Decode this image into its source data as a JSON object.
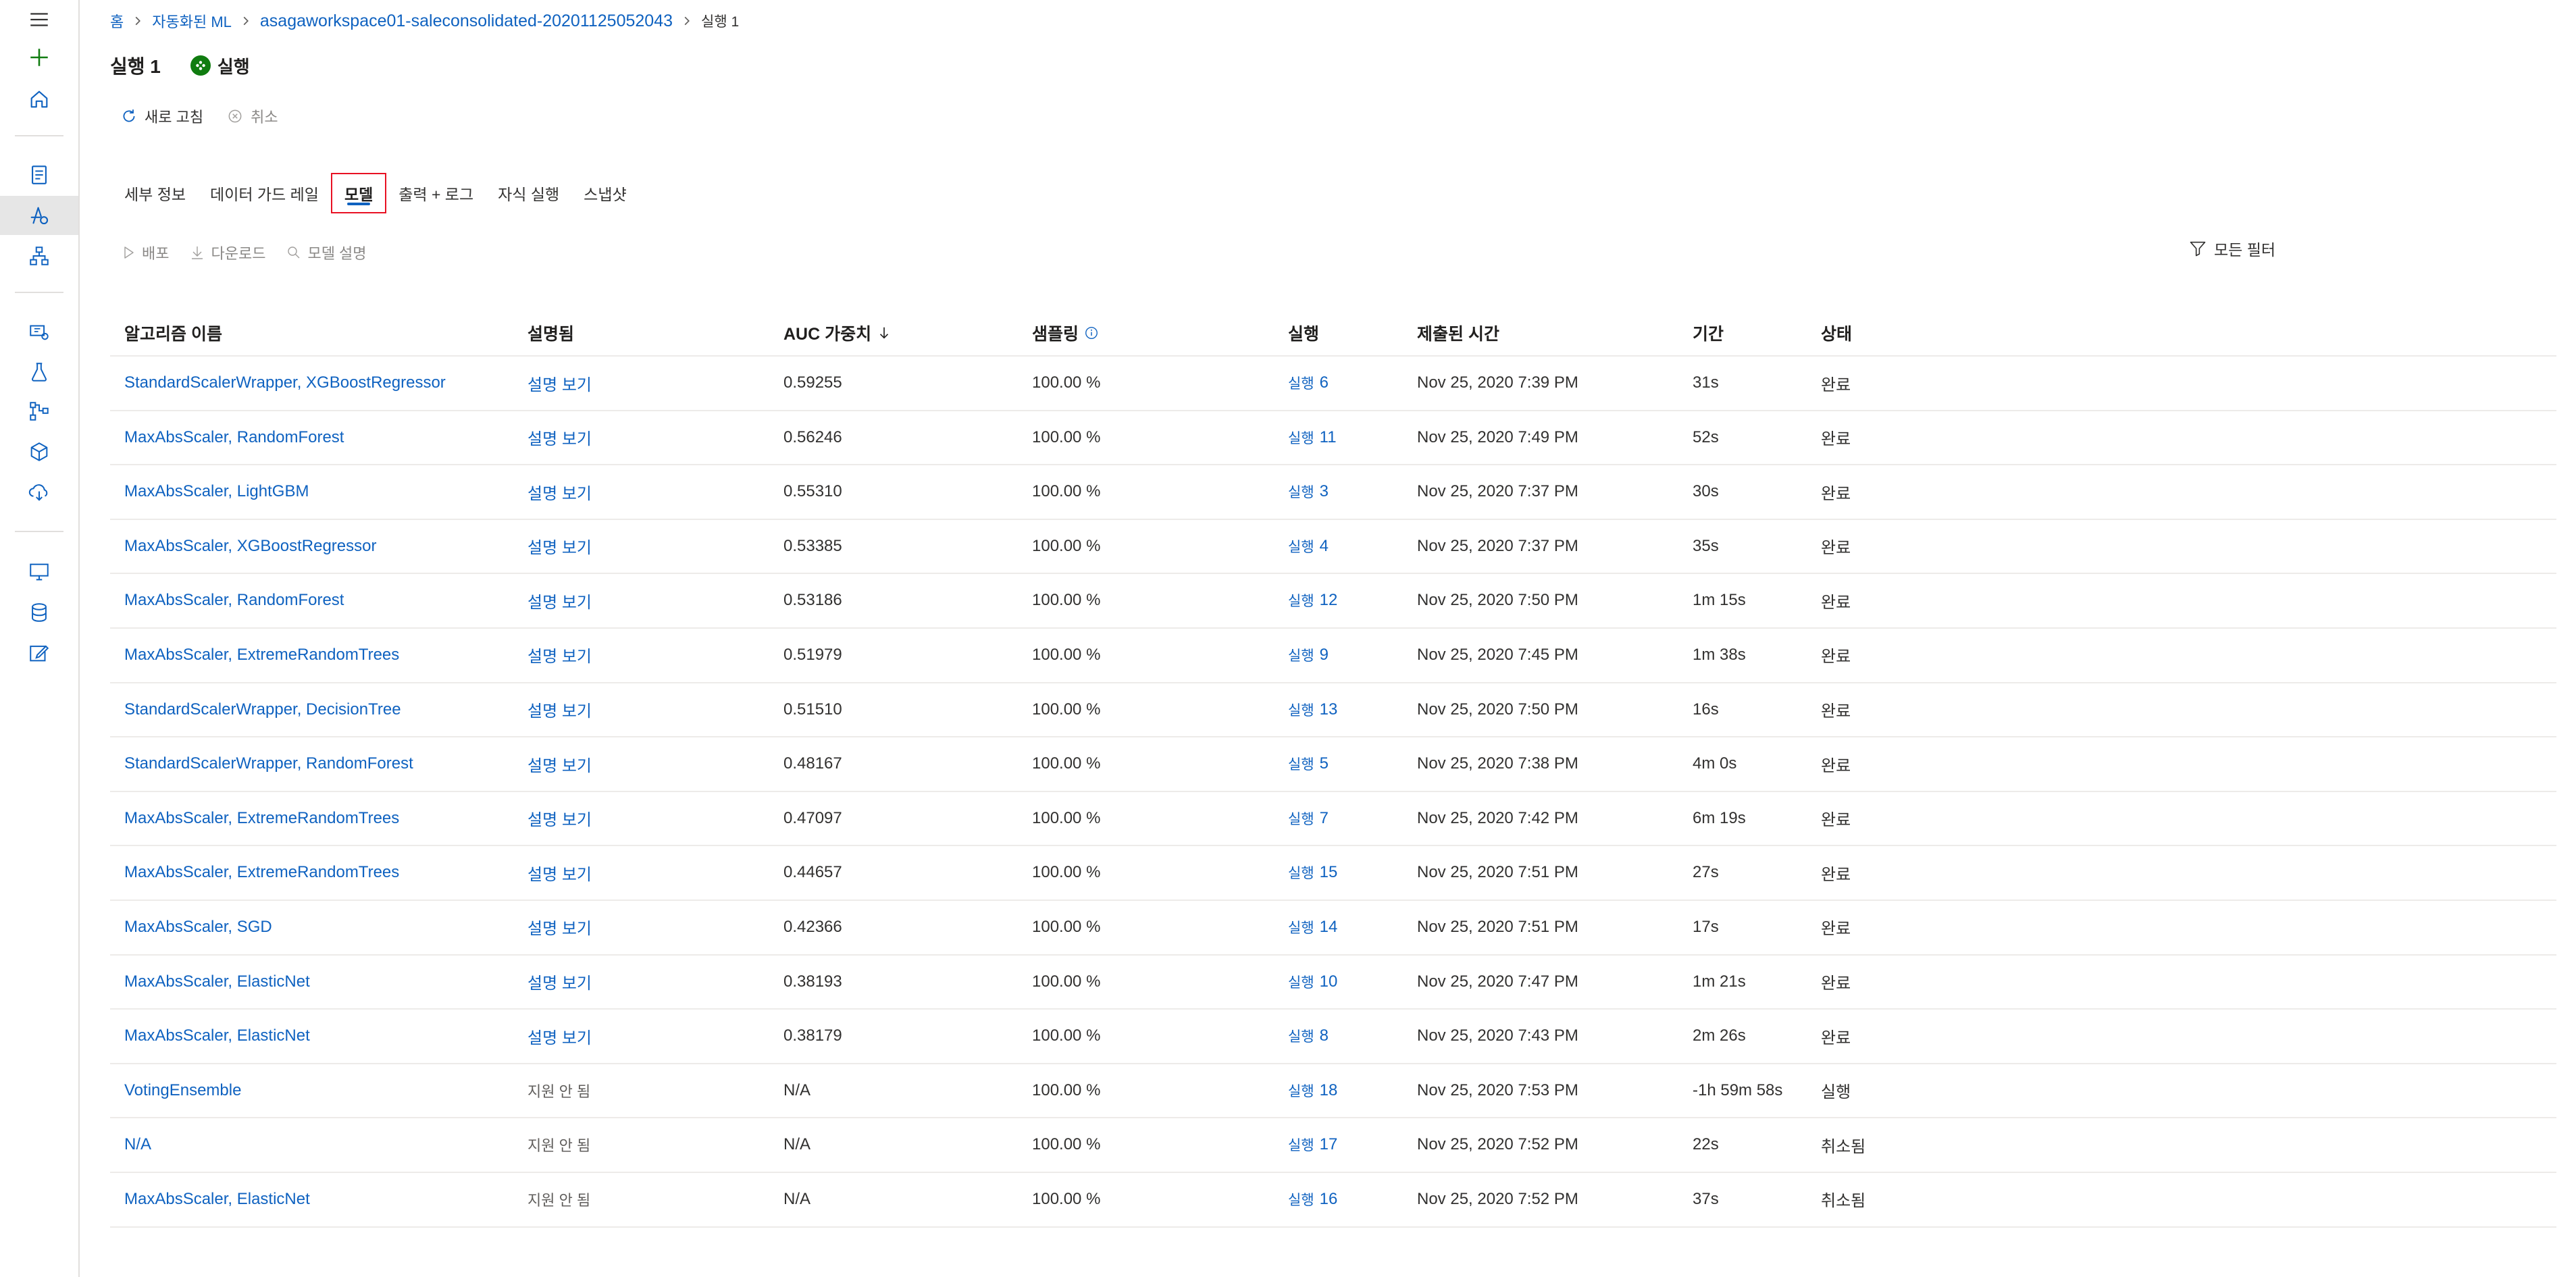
{
  "breadcrumb": {
    "home": "홈",
    "automl": "자동화된 ML",
    "experiment": "asagaworkspace01-saleconsolidated-20201125052043",
    "current": "실행 1"
  },
  "header": {
    "title": "실행 1",
    "status_label": "실행",
    "status_color": "#107c10"
  },
  "toolbar": {
    "refresh_label": "새로 고침",
    "cancel_label": "취소"
  },
  "tabs": [
    {
      "label": "세부 정보"
    },
    {
      "label": "데이터 가드 레일"
    },
    {
      "label": "모델",
      "selected": true
    },
    {
      "label": "출력 + 로그"
    },
    {
      "label": "자식 실행"
    },
    {
      "label": "스냅샷"
    }
  ],
  "model_actions": {
    "deploy_label": "배포",
    "download_label": "다운로드",
    "explain_label": "모델 설명",
    "filter_label": "모든 필터"
  },
  "table": {
    "columns": {
      "algorithm": "알고리즘 이름",
      "explained": "설명됨",
      "auc": "AUC 가중치",
      "sampling": "샘플링",
      "run": "실행",
      "submitted": "제출된 시간",
      "duration": "기간",
      "status": "상태"
    },
    "rows": [
      {
        "algorithm": "StandardScalerWrapper, XGBoostRegressor",
        "explained": "설명 보기",
        "explained_link": true,
        "auc": "0.59255",
        "sampling": "100.00 %",
        "run_prefix": "실행",
        "run_num": "6",
        "submitted": "Nov 25, 2020 7:39 PM",
        "duration": "31s",
        "status": "완료"
      },
      {
        "algorithm": "MaxAbsScaler, RandomForest",
        "explained": "설명 보기",
        "explained_link": true,
        "auc": "0.56246",
        "sampling": "100.00 %",
        "run_prefix": "실행",
        "run_num": "11",
        "submitted": "Nov 25, 2020 7:49 PM",
        "duration": "52s",
        "status": "완료"
      },
      {
        "algorithm": "MaxAbsScaler, LightGBM",
        "explained": "설명 보기",
        "explained_link": true,
        "auc": "0.55310",
        "sampling": "100.00 %",
        "run_prefix": "실행",
        "run_num": "3",
        "submitted": "Nov 25, 2020 7:37 PM",
        "duration": "30s",
        "status": "완료"
      },
      {
        "algorithm": "MaxAbsScaler, XGBoostRegressor",
        "explained": "설명 보기",
        "explained_link": true,
        "auc": "0.53385",
        "sampling": "100.00 %",
        "run_prefix": "실행",
        "run_num": "4",
        "submitted": "Nov 25, 2020 7:37 PM",
        "duration": "35s",
        "status": "완료"
      },
      {
        "algorithm": "MaxAbsScaler, RandomForest",
        "explained": "설명 보기",
        "explained_link": true,
        "auc": "0.53186",
        "sampling": "100.00 %",
        "run_prefix": "실행",
        "run_num": "12",
        "submitted": "Nov 25, 2020 7:50 PM",
        "duration": "1m 15s",
        "status": "완료"
      },
      {
        "algorithm": "MaxAbsScaler, ExtremeRandomTrees",
        "explained": "설명 보기",
        "explained_link": true,
        "auc": "0.51979",
        "sampling": "100.00 %",
        "run_prefix": "실행",
        "run_num": "9",
        "submitted": "Nov 25, 2020 7:45 PM",
        "duration": "1m 38s",
        "status": "완료"
      },
      {
        "algorithm": "StandardScalerWrapper, DecisionTree",
        "explained": "설명 보기",
        "explained_link": true,
        "auc": "0.51510",
        "sampling": "100.00 %",
        "run_prefix": "실행",
        "run_num": "13",
        "submitted": "Nov 25, 2020 7:50 PM",
        "duration": "16s",
        "status": "완료"
      },
      {
        "algorithm": "StandardScalerWrapper, RandomForest",
        "explained": "설명 보기",
        "explained_link": true,
        "auc": "0.48167",
        "sampling": "100.00 %",
        "run_prefix": "실행",
        "run_num": "5",
        "submitted": "Nov 25, 2020 7:38 PM",
        "duration": "4m 0s",
        "status": "완료"
      },
      {
        "algorithm": "MaxAbsScaler, ExtremeRandomTrees",
        "explained": "설명 보기",
        "explained_link": true,
        "auc": "0.47097",
        "sampling": "100.00 %",
        "run_prefix": "실행",
        "run_num": "7",
        "submitted": "Nov 25, 2020 7:42 PM",
        "duration": "6m 19s",
        "status": "완료"
      },
      {
        "algorithm": "MaxAbsScaler, ExtremeRandomTrees",
        "explained": "설명 보기",
        "explained_link": true,
        "auc": "0.44657",
        "sampling": "100.00 %",
        "run_prefix": "실행",
        "run_num": "15",
        "submitted": "Nov 25, 2020 7:51 PM",
        "duration": "27s",
        "status": "완료"
      },
      {
        "algorithm": "MaxAbsScaler, SGD",
        "explained": "설명 보기",
        "explained_link": true,
        "auc": "0.42366",
        "sampling": "100.00 %",
        "run_prefix": "실행",
        "run_num": "14",
        "submitted": "Nov 25, 2020 7:51 PM",
        "duration": "17s",
        "status": "완료"
      },
      {
        "algorithm": "MaxAbsScaler, ElasticNet",
        "explained": "설명 보기",
        "explained_link": true,
        "auc": "0.38193",
        "sampling": "100.00 %",
        "run_prefix": "실행",
        "run_num": "10",
        "submitted": "Nov 25, 2020 7:47 PM",
        "duration": "1m 21s",
        "status": "완료"
      },
      {
        "algorithm": "MaxAbsScaler, ElasticNet",
        "explained": "설명 보기",
        "explained_link": true,
        "auc": "0.38179",
        "sampling": "100.00 %",
        "run_prefix": "실행",
        "run_num": "8",
        "submitted": "Nov 25, 2020 7:43 PM",
        "duration": "2m 26s",
        "status": "완료"
      },
      {
        "algorithm": "VotingEnsemble",
        "explained": "지원 안 됨",
        "explained_link": false,
        "auc": "N/A",
        "sampling": "100.00 %",
        "run_prefix": "실행",
        "run_num": "18",
        "submitted": "Nov 25, 2020 7:53 PM",
        "duration": "-1h 59m 58s",
        "status": "실행"
      },
      {
        "algorithm": "N/A",
        "explained": "지원 안 됨",
        "explained_link": false,
        "auc": "N/A",
        "sampling": "100.00 %",
        "run_prefix": "실행",
        "run_num": "17",
        "submitted": "Nov 25, 2020 7:52 PM",
        "duration": "22s",
        "status": "취소됨"
      },
      {
        "algorithm": "MaxAbsScaler, ElasticNet",
        "explained": "지원 안 됨",
        "explained_link": false,
        "auc": "N/A",
        "sampling": "100.00 %",
        "run_prefix": "실행",
        "run_num": "16",
        "submitted": "Nov 25, 2020 7:52 PM",
        "duration": "37s",
        "status": "취소됨"
      }
    ]
  }
}
